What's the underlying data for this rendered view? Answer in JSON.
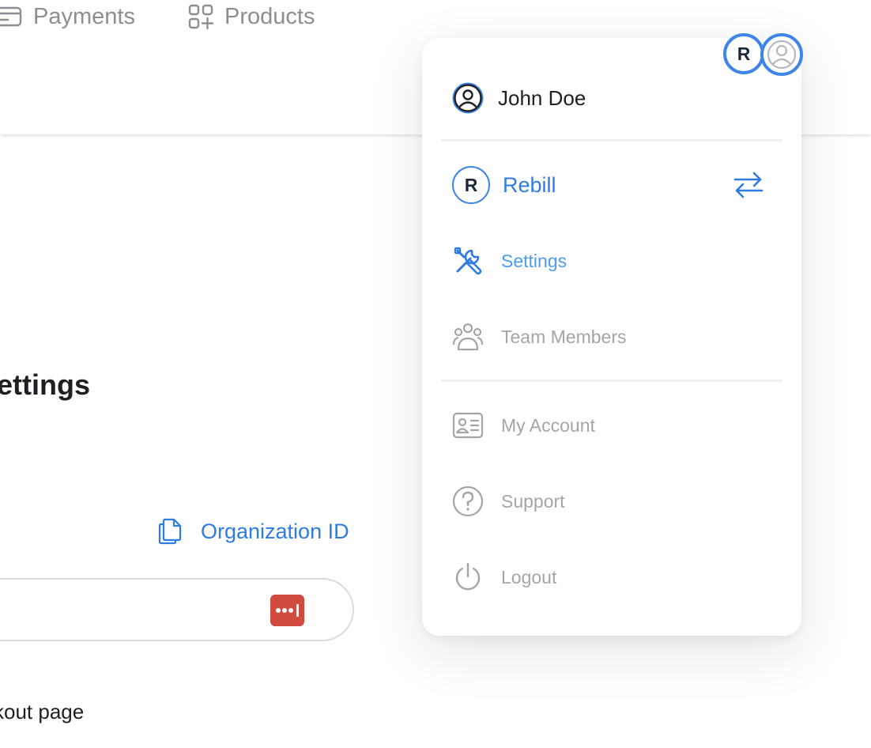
{
  "nav": {
    "payments_label": "Payments",
    "products_label": "Products"
  },
  "page": {
    "title": "ettings",
    "org_id_link": "Organization ID",
    "checkout_text": "kout page"
  },
  "header": {
    "org_initial": "R"
  },
  "menu": {
    "user_name": "John Doe",
    "org_name": "Rebill",
    "org_initial": "R",
    "items": [
      {
        "label": "Settings",
        "icon": "tools-icon"
      },
      {
        "label": "Team Members",
        "icon": "team-icon"
      },
      {
        "label": "My Account",
        "icon": "id-card-icon"
      },
      {
        "label": "Support",
        "icon": "question-icon"
      },
      {
        "label": "Logout",
        "icon": "power-icon"
      }
    ]
  },
  "colors": {
    "accent": "#2f7be5",
    "settings_active": "#4b9cf0",
    "muted": "#a2a5aa",
    "password_badge": "#d14b3f"
  }
}
